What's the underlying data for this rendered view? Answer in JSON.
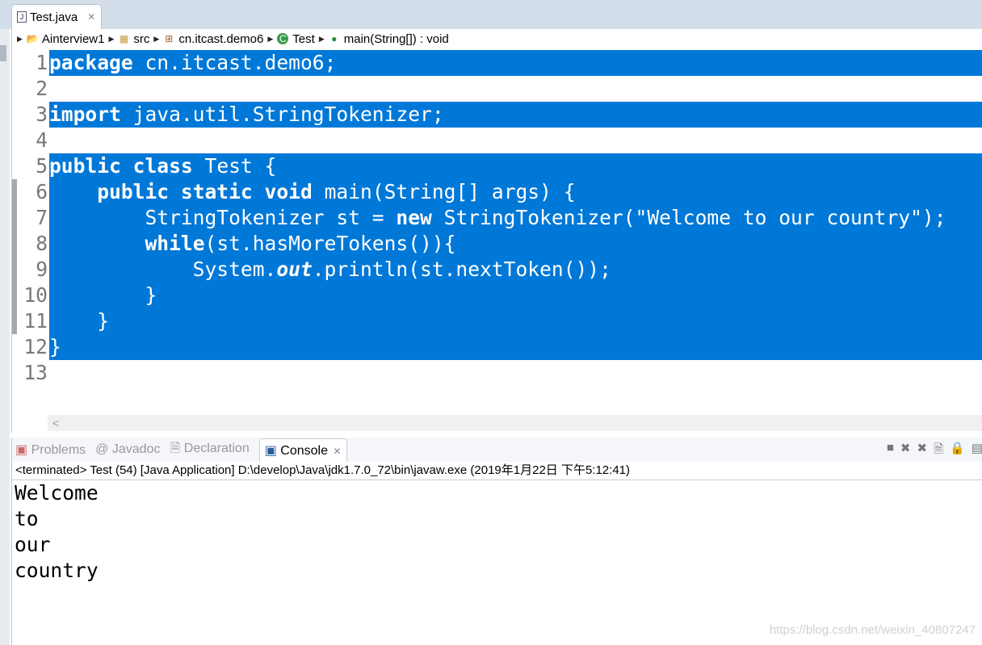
{
  "editor": {
    "tab_title": "Test.java",
    "breadcrumbs": [
      "Ainterview1",
      "src",
      "cn.itcast.demo6",
      "Test",
      "main(String[]) : void"
    ],
    "lines": [
      [
        {
          "t": "package",
          "s": "kw"
        },
        {
          "t": " cn.itcast.demo6;",
          "s": ""
        }
      ],
      [],
      [
        {
          "t": "import",
          "s": "kw"
        },
        {
          "t": " java.util.StringTokenizer;",
          "s": ""
        }
      ],
      [],
      [
        {
          "t": "public",
          "s": "kw"
        },
        {
          "t": " ",
          "s": ""
        },
        {
          "t": "class",
          "s": "kw"
        },
        {
          "t": " Test {",
          "s": ""
        }
      ],
      [
        {
          "t": "    ",
          "s": ""
        },
        {
          "t": "public",
          "s": "kw"
        },
        {
          "t": " ",
          "s": ""
        },
        {
          "t": "static",
          "s": "kw"
        },
        {
          "t": " ",
          "s": ""
        },
        {
          "t": "void",
          "s": "kw"
        },
        {
          "t": " main(String[] args) {",
          "s": ""
        }
      ],
      [
        {
          "t": "        StringTokenizer st = ",
          "s": ""
        },
        {
          "t": "new",
          "s": "kw"
        },
        {
          "t": " StringTokenizer(\"Welcome to our country\");",
          "s": ""
        }
      ],
      [
        {
          "t": "        ",
          "s": ""
        },
        {
          "t": "while",
          "s": "kw"
        },
        {
          "t": "(st.hasMoreTokens()){",
          "s": ""
        }
      ],
      [
        {
          "t": "            System.",
          "s": ""
        },
        {
          "t": "out",
          "s": "it"
        },
        {
          "t": ".println(st.nextToken());",
          "s": ""
        }
      ],
      [
        {
          "t": "        }",
          "s": ""
        }
      ],
      [
        {
          "t": "    }",
          "s": ""
        }
      ],
      [
        {
          "t": "}",
          "s": ""
        }
      ],
      []
    ],
    "selected_lines": 12
  },
  "console": {
    "tabs": [
      "Problems",
      "Javadoc",
      "Declaration",
      "Console"
    ],
    "status": "<terminated> Test (54) [Java Application] D:\\develop\\Java\\jdk1.7.0_72\\bin\\javaw.exe (2019年1月22日 下午5:12:41)",
    "output": [
      "Welcome",
      "to",
      "our",
      "country"
    ]
  },
  "watermark": "https://blog.csdn.net/weixin_40807247",
  "colors": {
    "selection": "#0078d7"
  }
}
